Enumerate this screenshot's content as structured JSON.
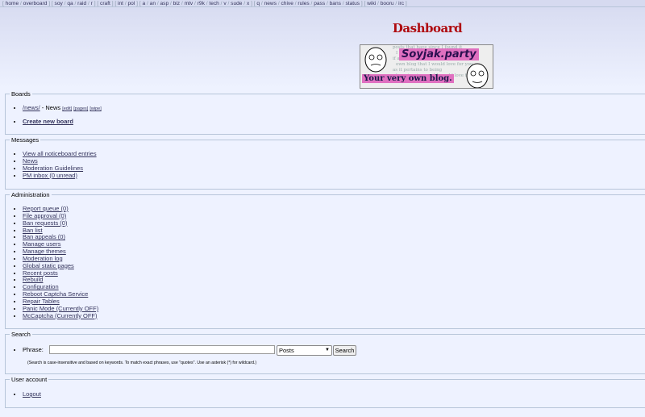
{
  "boardlist": {
    "groups": [
      [
        "home",
        "overboard"
      ],
      [
        "soy",
        "qa",
        "raid",
        "r"
      ],
      [
        "craft"
      ],
      [
        "int",
        "pol"
      ],
      [
        "a",
        "an",
        "asp",
        "biz",
        "mtv",
        "r9k",
        "tech",
        "v",
        "sude",
        "x"
      ],
      [
        "q",
        "news",
        "chive",
        "rules",
        "pass",
        "bans",
        "status"
      ],
      [
        "wiki",
        "booru",
        "irc"
      ]
    ]
  },
  "page": {
    "title": "Dashboard"
  },
  "banner": {
    "title": "Soyjak.party",
    "tagline": "Your very own blog.",
    "bg_lines": [
      "posts that have since I found it",
      "I share I was wondering if we could",
      "if all of the blogs of the girls here",
      "own blog that I would love for you",
      "as it pertains to being",
      "here is mine, and I would love to finish"
    ]
  },
  "boards": {
    "legend": "Boards",
    "board_link": "/news/",
    "board_name": " - News ",
    "edit": "[edit]",
    "pages": "[pages]",
    "wipe": "[wipe]",
    "create": "Create new board"
  },
  "messages": {
    "legend": "Messages",
    "items": [
      "View all noticeboard entries",
      "News",
      "Moderation Guidelines",
      "PM inbox (0 unread)"
    ]
  },
  "administration": {
    "legend": "Administration",
    "items": [
      "Report queue (0)",
      "File approval (0)",
      "Ban requests (0)",
      "Ban list",
      "Ban appeals (0)",
      "Manage users",
      "Manage themes",
      "Moderation log",
      "Global static pages",
      "Recent posts",
      "Rebuild",
      "Configuration",
      "Reboot Captcha Service",
      "Repair Tables",
      "Panic Mode (Currently OFF)",
      "McCaptcha (Currently OFF)"
    ]
  },
  "search": {
    "legend": "Search",
    "label": "Phrase:",
    "value": "",
    "select_value": "Posts",
    "button": "Search",
    "hint": "(Search is case-insensitive and based on keywords. To match exact phrases, use \"quotes\". Use an asterisk (*) for wildcard.)"
  },
  "account": {
    "legend": "User account",
    "logout": "Logout"
  }
}
